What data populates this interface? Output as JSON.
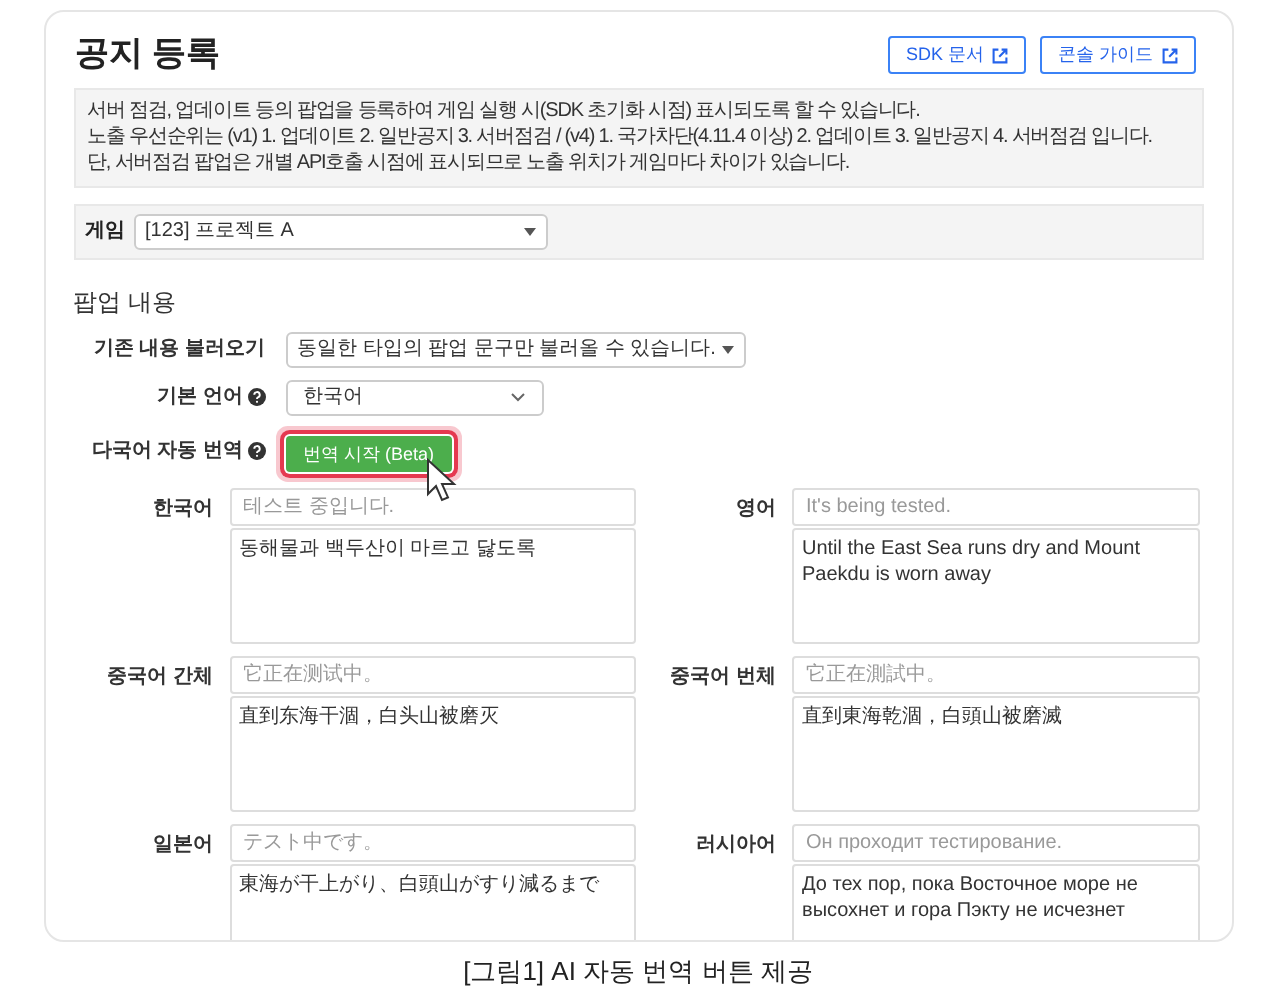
{
  "title": "공지 등록",
  "header_buttons": [
    {
      "label": "SDK 문서"
    },
    {
      "label": "콘솔 가이드"
    }
  ],
  "notice": [
    "서버 점검, 업데이트 등의 팝업을 등록하여 게임 실행 시(SDK 초기화 시점) 표시되도록 할 수 있습니다.",
    "노출 우선순위는 (v1) 1. 업데이트 2. 일반공지 3. 서버점검 / (v4) 1. 국가차단(4.11.4 이상) 2. 업데이트 3. 일반공지 4. 서버점검 입니다.",
    "단, 서버점검 팝업은 개별 API호출 시점에 표시되므로 노출 위치가 게임마다 차이가 있습니다."
  ],
  "game": {
    "label": "게임",
    "value": "[123] 프로젝트 A"
  },
  "section_title": "팝업 내용",
  "load_previous": {
    "label": "기존 내용 불러오기",
    "value": "동일한 타입의 팝업 문구만 불러올 수 있습니다."
  },
  "base_language": {
    "label": "기본 언어",
    "value": "한국어"
  },
  "auto_translate": {
    "label": "다국어 자동 번역",
    "button": "번역 시작 (Beta)"
  },
  "translations": [
    {
      "language": "한국어",
      "placeholder": "테스트 중입니다.",
      "value": "동해물과 백두산이 마르고 닳도록"
    },
    {
      "language": "영어",
      "placeholder": "It's being tested.",
      "value": "Until the East Sea runs dry and Mount Paekdu is worn away"
    },
    {
      "language": "중국어 간체",
      "placeholder": "它正在测试中。",
      "value": "直到东海干涸，白头山被磨灭"
    },
    {
      "language": "중국어 번체",
      "placeholder": "它正在測試中。",
      "value": "直到東海乾涸，白頭山被磨滅"
    },
    {
      "language": "일본어",
      "placeholder": "テスト中です。",
      "value": "東海が干上がり、白頭山がすり減るまで"
    },
    {
      "language": "러시아어",
      "placeholder": "Он проходит тестирование.",
      "value": "До тех пор, пока Восточное море не высохнет и гора Пэкту не исчезнет"
    }
  ],
  "caption": "[그림1] AI 자동 번역 버튼 제공"
}
